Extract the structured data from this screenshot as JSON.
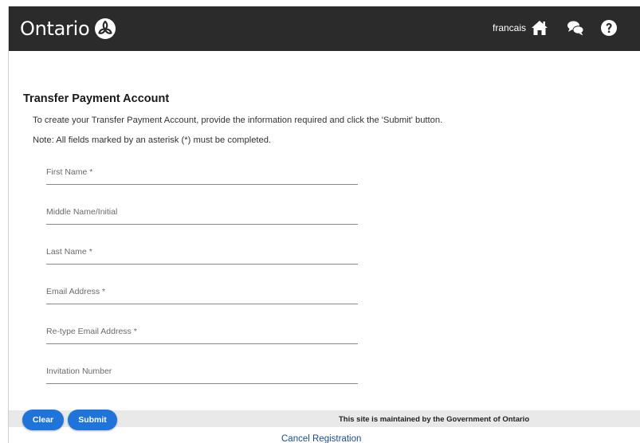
{
  "header": {
    "logo_text": "Ontario",
    "language_link": "francais",
    "icons": [
      "logo-trillium-icon",
      "home-icon",
      "chat-icon",
      "help-icon"
    ],
    "background": "#2b2b2b"
  },
  "main": {
    "title": "Transfer Payment Account",
    "intro": "To create your Transfer Payment Account, provide the information required and click the 'Submit' button.",
    "note": "Note: All fields marked by an asterisk (*) must be completed.",
    "fields": [
      {
        "placeholder": "First Name *",
        "value": ""
      },
      {
        "placeholder": "Middle Name/Initial",
        "value": ""
      },
      {
        "placeholder": "Last Name *",
        "value": ""
      },
      {
        "placeholder": "Email Address *",
        "value": ""
      },
      {
        "placeholder": "Re-type Email Address *",
        "value": ""
      },
      {
        "placeholder": "Invitation Number",
        "value": ""
      }
    ]
  },
  "actions": {
    "clear_label": "Clear",
    "submit_label": "Submit",
    "cancel_label": "Cancel Registration",
    "accent": "#1e74d9"
  },
  "footer": {
    "text": "This site is maintained by the Government of Ontario"
  }
}
